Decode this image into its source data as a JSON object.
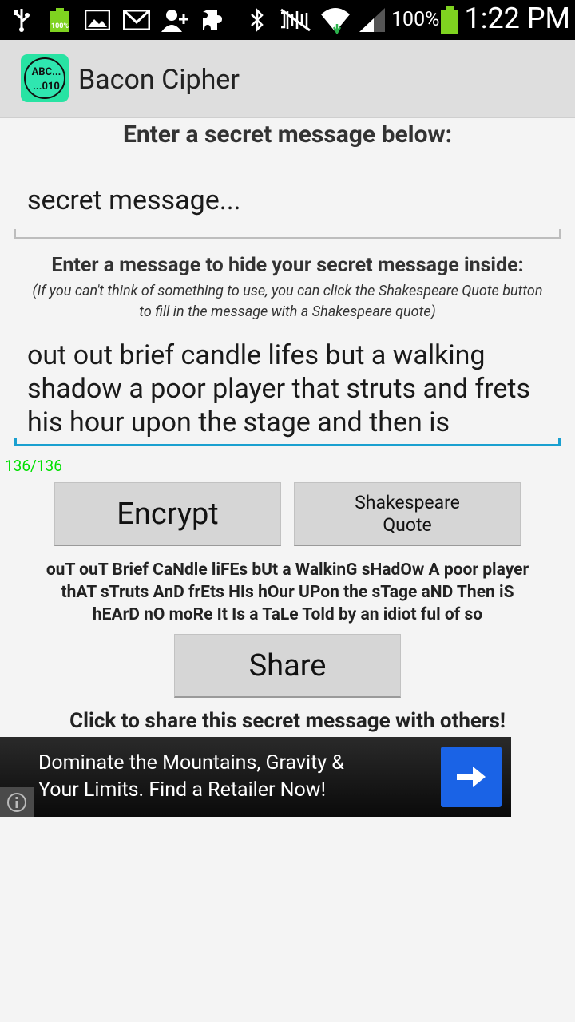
{
  "status_bar": {
    "battery_level_label": "100%",
    "battery_percent": "100%",
    "time": "1:22 PM",
    "icons": [
      "usb-icon",
      "battery-icon",
      "image-icon",
      "gmail-icon",
      "add-contact-icon",
      "puzzle-icon",
      "bluetooth-icon",
      "mute-icon",
      "wifi-icon",
      "signal-icon",
      "battery-icon"
    ]
  },
  "app_bar": {
    "logo_line1": "ABC...",
    "logo_line2": "...010",
    "title": "Bacon Cipher"
  },
  "secret_section": {
    "label": "Enter a secret message below:",
    "input_value": "secret message..."
  },
  "cover_section": {
    "label": "Enter a message to hide your secret message inside:",
    "hint_line1": "(If you can't think of something to use, you can click the Shakespeare Quote button",
    "hint_line2": "to fill in the message with a Shakespeare quote)",
    "input_value": "out out brief candle lifes but a walking shadow a poor player that struts and frets his hour upon the stage and then is",
    "char_counter": "136/136"
  },
  "buttons": {
    "encrypt": "Encrypt",
    "shakespeare_line1": "Shakespeare",
    "shakespeare_line2": "Quote",
    "share": "Share"
  },
  "result": {
    "line1": "ouT ouT Brief CaNdle liFEs bUt a WalkinG sHadOw A poor player",
    "line2": "thAT sTruts AnD frEts HIs hOur UPon the sTage aND Then iS",
    "line3": "hEArD nO moRe It Is a TaLe Told by an idiot ful of so"
  },
  "share_caption": "Click to share this secret message with others!",
  "ad": {
    "line1": "Dominate the Mountains, Gravity &",
    "line2": "Your Limits. Find a Retailer Now!"
  },
  "colors": {
    "accent_blue": "#1aa0d0",
    "counter_green": "#00e000",
    "ad_button": "#1a63e6",
    "logo_green": "#28e3a3"
  }
}
